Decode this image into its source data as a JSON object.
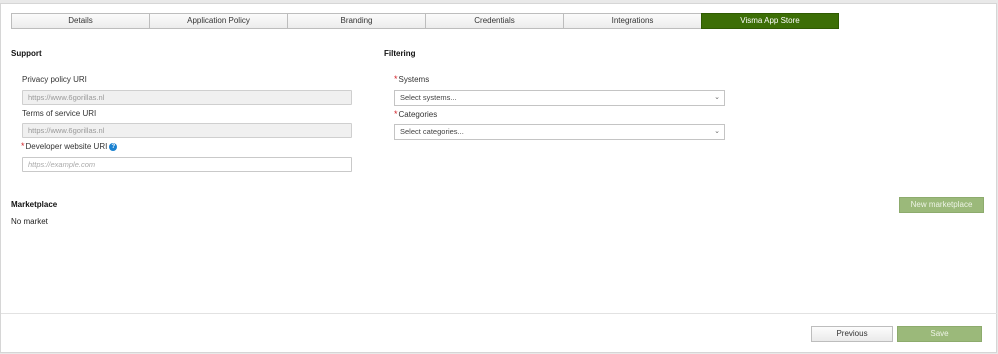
{
  "tabs": [
    {
      "label": "Details",
      "active": false
    },
    {
      "label": "Application Policy",
      "active": false
    },
    {
      "label": "Branding",
      "active": false
    },
    {
      "label": "Credentials",
      "active": false
    },
    {
      "label": "Integrations",
      "active": false
    },
    {
      "label": "Visma App Store",
      "active": true
    }
  ],
  "support": {
    "title": "Support",
    "privacy_label": "Privacy policy URI",
    "privacy_value": "https://www.6gorillas.nl",
    "terms_label": "Terms of service URI",
    "terms_value": "https://www.6gorillas.nl",
    "dev_label": "Developer website URI",
    "dev_placeholder": "https://example.com",
    "help_glyph": "?"
  },
  "filtering": {
    "title": "Filtering",
    "systems_label": "Systems",
    "systems_placeholder": "Select systems...",
    "categories_label": "Categories",
    "categories_placeholder": "Select categories..."
  },
  "required_mark": "*",
  "marketplace": {
    "title": "Marketplace",
    "empty_text": "No market",
    "new_button": "New marketplace"
  },
  "footer": {
    "previous": "Previous",
    "save": "Save"
  },
  "colors": {
    "active_tab": "#3c6e06",
    "disabled_button": "#9bb97a",
    "required": "#d2232a",
    "help": "#1b82d1"
  },
  "icons": {
    "select_chevron": "chevron-down-icon",
    "help": "help-icon"
  }
}
